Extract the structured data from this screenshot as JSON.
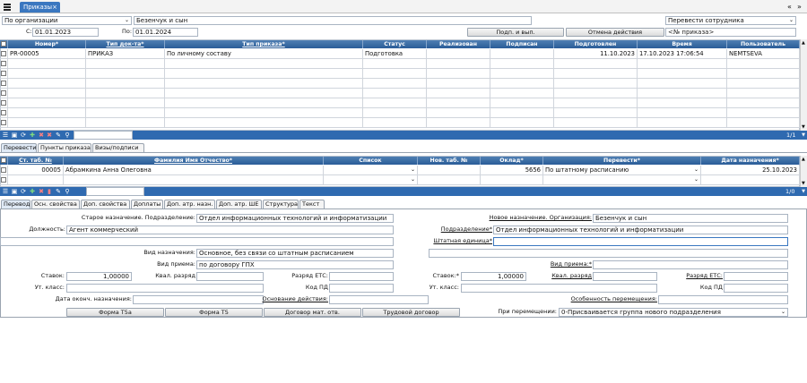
{
  "top": {
    "menu_icon": "hamburger-icon",
    "tab_title": "Приказы",
    "nav_prev": "«",
    "nav_next": "»"
  },
  "filters": {
    "org_select": "По организации",
    "org_value": "Безенчук и сын",
    "action_select": "Перевести сотрудника",
    "from_label": "С:",
    "from_value": "01.01.2023",
    "to_label": "По:",
    "to_value": "01.01.2024",
    "sign_button": "Подп. и вып.",
    "cancel_button": "Отмена действия",
    "order_no_placeholder": "<№ приказа>"
  },
  "orders": {
    "columns": [
      "Номер*",
      "Тип док-та*",
      "Тип приказа*",
      "Статус",
      "Реализован",
      "Подписан",
      "Подготовлен",
      "Время",
      "Пользователь"
    ],
    "rows": [
      {
        "number": "PR-00005",
        "doc_type": "ПРИКАЗ",
        "order_type": "По личному составу",
        "status": "Подготовка",
        "realized": "",
        "signed": "",
        "prepared": "11.10.2023",
        "time": "17.10.2023 17:06:54",
        "user": "NEMTSEVA"
      }
    ],
    "pager": "1/1"
  },
  "tabs1": [
    "Перевести",
    "Пункты приказа",
    "Визы/подписи"
  ],
  "employees": {
    "columns": [
      "Ст. таб. №",
      "Фамилия Имя Отчество*",
      "Список",
      "Нов. таб. №",
      "Оклад*",
      "Перевести*",
      "Дата назначения*"
    ],
    "rows": [
      {
        "tab": "00005",
        "name": "Абрамкина Анна Олеговна",
        "list": "",
        "new_tab": "",
        "salary": "5656",
        "transfer": "По штатному расписанию",
        "date": "25.10.2023"
      }
    ],
    "pager": "1/0"
  },
  "tabs2": [
    "Перевод",
    "Осн. свойства",
    "Доп. свойства",
    "Доплаты",
    "Доп. атр. назн.",
    "Доп. атр. ШЕ",
    "Структура",
    "Текст"
  ],
  "form": {
    "old_unit_label": "Старое назначение. Подразделение:",
    "old_unit_value": "Отдел информационных технологий и информатизации",
    "position_label": "Должность:",
    "position_value": "Агент коммерческий",
    "new_org_label": "Новое назначение. Организация:",
    "new_org_value": "Безенчук и сын",
    "new_unit_label": "Подразделение*",
    "new_unit_value": "Отдел информационных технологий и информатизации",
    "staff_unit_label": "Штатная единица*",
    "assign_kind_label": "Вид назначения:",
    "assign_kind_value": "Основное, без связи со штатным расписанием",
    "hire_kind_label": "Вид приема:",
    "hire_kind_value": "по договору ГПХ",
    "hire_kind2_label": "Вид приема:*",
    "rates_label": "Ставок:",
    "rates_value": "1,00000",
    "qual_label": "Квал. разряд",
    "ets_label": "Разряд ЕТС:",
    "rates2_label": "Ставок:*",
    "rates2_value": "1,00000",
    "qual2_label": "Квал. разряд",
    "ets2_label": "Разряд ЕТС:",
    "class_label": "Ут. класс:",
    "pd_label": "Код ПД",
    "class2_label": "Ут. класс:",
    "pd2_label": "Код ПД",
    "end_date_label": "Дата оконч. назначения:",
    "basis_label": "Основание действия:",
    "feature_label": "Особенность перемещения:",
    "btn_t5a": "Форма Т5а",
    "btn_t5": "Форма Т5",
    "btn_contract_resp": "Договор мат. отв.",
    "btn_labor": "Трудовой договор",
    "move_label": "При перемещении:",
    "move_value": "0-Присваивается группа нового подразделения"
  }
}
